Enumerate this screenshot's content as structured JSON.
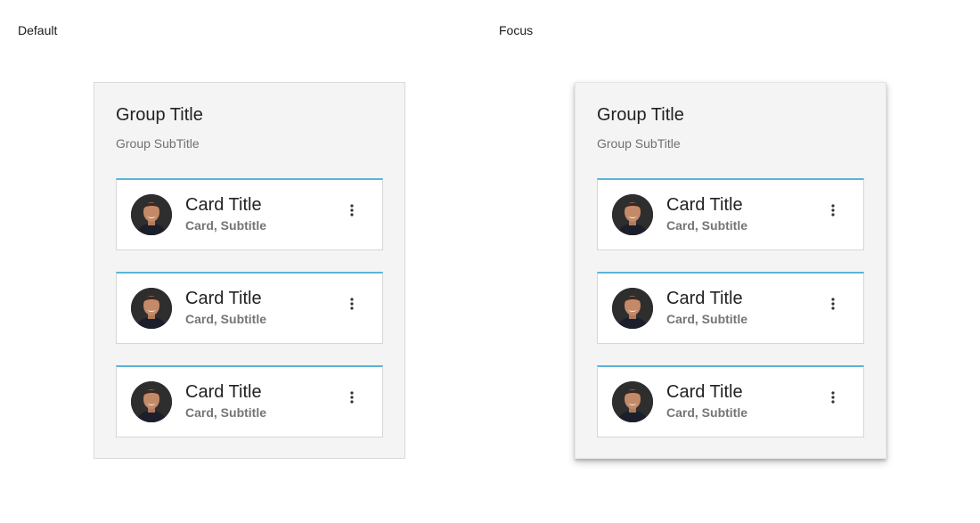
{
  "states": [
    {
      "label": "Default",
      "group": {
        "title": "Group Title",
        "subtitle": "Group SubTitle",
        "cards": [
          {
            "title": "Card Title",
            "subtitle": "Card, Subtitle",
            "avatar_icon": "person-photo",
            "menu_icon": "more-vertical-icon"
          },
          {
            "title": "Card Title",
            "subtitle": "Card, Subtitle",
            "avatar_icon": "person-photo",
            "menu_icon": "more-vertical-icon"
          },
          {
            "title": "Card Title",
            "subtitle": "Card, Subtitle",
            "avatar_icon": "person-photo",
            "menu_icon": "more-vertical-icon"
          }
        ]
      }
    },
    {
      "label": "Focus",
      "group": {
        "title": "Group Title",
        "subtitle": "Group SubTitle",
        "cards": [
          {
            "title": "Card Title",
            "subtitle": "Card, Subtitle",
            "avatar_icon": "person-photo",
            "menu_icon": "more-vertical-icon"
          },
          {
            "title": "Card Title",
            "subtitle": "Card, Subtitle",
            "avatar_icon": "person-photo",
            "menu_icon": "more-vertical-icon"
          },
          {
            "title": "Card Title",
            "subtitle": "Card, Subtitle",
            "avatar_icon": "person-photo",
            "menu_icon": "more-vertical-icon"
          }
        ]
      }
    }
  ],
  "colors": {
    "card_accent": "#5ab4d8",
    "group_background": "#f4f4f4",
    "card_background": "#ffffff",
    "title_text": "#222222",
    "subtitle_text": "#757575"
  }
}
